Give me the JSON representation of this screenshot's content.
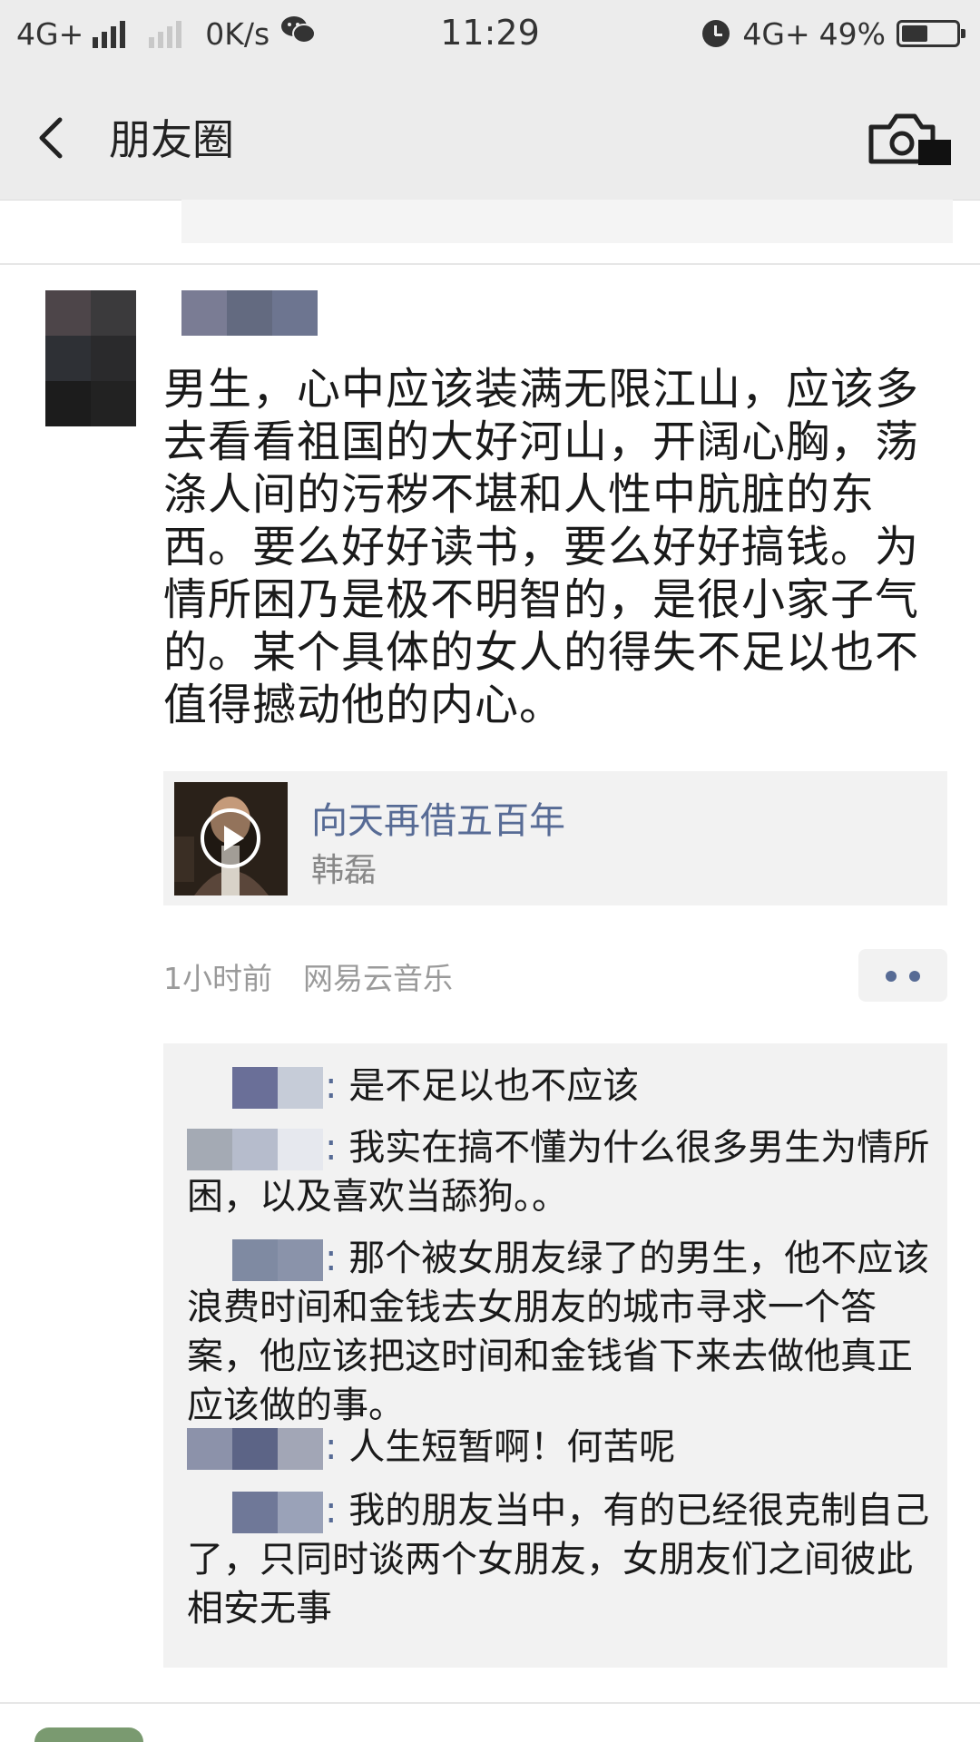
{
  "status_bar": {
    "network_left": "4G+",
    "speed": "0K/s",
    "time": "11:29",
    "network_right": "4G+",
    "battery_percent": "49%",
    "battery_level": 0.49
  },
  "nav": {
    "title": "朋友圈",
    "back_icon": "chevron-left-icon",
    "camera_icon": "camera-icon"
  },
  "post": {
    "text": "男生，心中应该装满无限江山，应该多去看看祖国的大好河山，开阔心胸，荡涤人间的污秽不堪和人性中肮脏的东西。要么好好读书，要么好好搞钱。为情所困乃是极不明智的，是很小家子气的。某个具体的女人的得失不足以也不值得撼动他的内心。",
    "music": {
      "title": "向天再借五百年",
      "artist": "韩磊",
      "play_icon": "play-icon"
    },
    "time_ago": "1小时前",
    "source": "网易云音乐",
    "more_icon": "more-dots-icon"
  },
  "comments": [
    {
      "separator": ":",
      "text": " 是不足以也不应该"
    },
    {
      "separator": ":",
      "text": " 我实在搞不懂为什么很多男生为情所困，以及喜欢当舔狗。。"
    },
    {
      "separator": ":",
      "text": " 那个被女朋友绿了的男生，他不应该浪费时间和金钱去女朋友的城市寻求一个答案，他应该把这时间和金钱省下来去做他真正应该做的事。"
    },
    {
      "separator": ":",
      "text": " 人生短暂啊！何苦呢"
    },
    {
      "separator": ":",
      "text": " 我的朋友当中，有的已经很克制自己了，只同时谈两个女朋友，女朋友们之间彼此相安无事"
    }
  ],
  "colors": {
    "link": "#576b95",
    "bar_bg": "#ececec",
    "card_bg": "#f2f2f2"
  }
}
